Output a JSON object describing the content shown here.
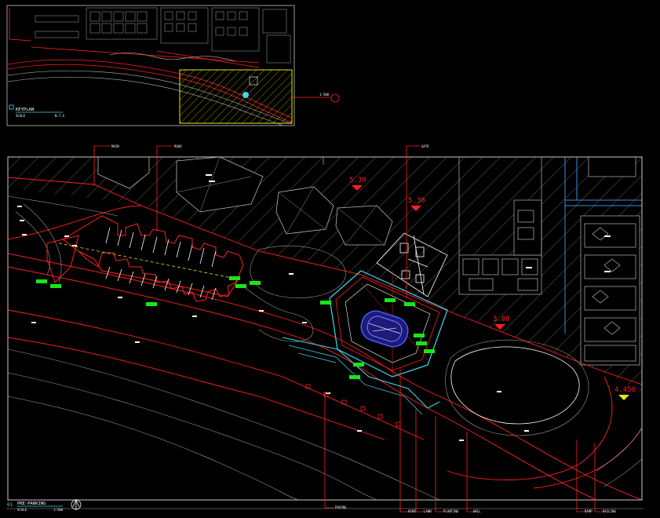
{
  "keyplan": {
    "title": "KEYPLAN",
    "scale_label": "SCALE",
    "scale_value": "N.T.S",
    "callout": "1:500"
  },
  "main_plan": {
    "title": "PRE-PARKING",
    "scale_label": "SCALE",
    "scale_value": "1:500",
    "number": "01"
  },
  "elevation_markers": [
    {
      "id": "el-1",
      "value": "5.30"
    },
    {
      "id": "el-2",
      "value": "5.30"
    },
    {
      "id": "el-3",
      "value": "3.00"
    },
    {
      "id": "el-4",
      "value": "4.450"
    }
  ],
  "top_tags": [
    {
      "id": "tag-a",
      "text": "MAIN"
    },
    {
      "id": "tag-b",
      "text": "ROAD"
    },
    {
      "id": "tag-c",
      "text": "GATE"
    }
  ],
  "bottom_tags": [
    {
      "id": "tag-d",
      "text": "PAVING"
    },
    {
      "id": "tag-e",
      "text": "KERB"
    },
    {
      "id": "tag-f",
      "text": "LAWN"
    },
    {
      "id": "tag-g",
      "text": "PLANTING"
    },
    {
      "id": "tag-h",
      "text": "WALL"
    },
    {
      "id": "tag-i",
      "text": "RAMP"
    },
    {
      "id": "tag-j",
      "text": "RAILING"
    }
  ],
  "colors": {
    "background": "#000000",
    "red": "#ff2020",
    "white": "#ffffff",
    "gray": "#9a9a9a",
    "cyan": "#3fd7f0",
    "blue": "#4a5cff",
    "yellow": "#e8e800",
    "green": "#19e619"
  }
}
